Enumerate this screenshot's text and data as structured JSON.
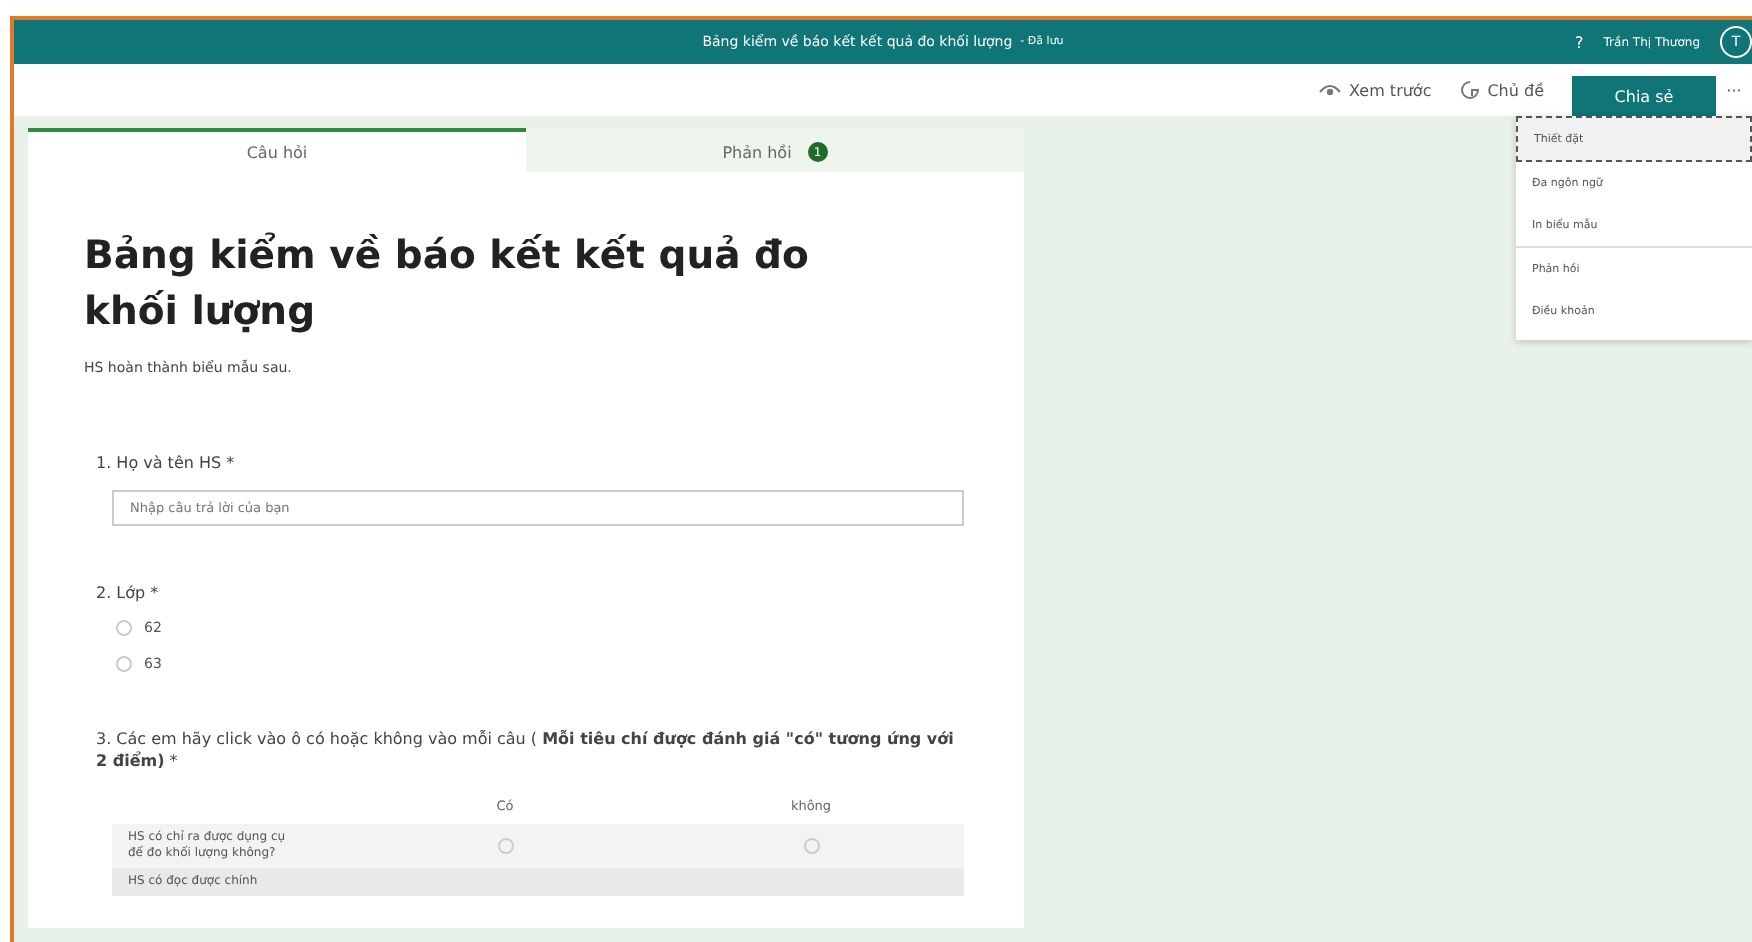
{
  "header": {
    "title": "Bảng kiểm về báo kết kết quả đo khối lượng",
    "save_status": "- Đã lưu",
    "help": "?",
    "user_name": "Trần Thị Thương",
    "avatar_initials": "T"
  },
  "toolbar": {
    "preview": "Xem trước",
    "theme": "Chủ đề",
    "share": "Chia sẻ",
    "more": "···"
  },
  "menu": {
    "items": [
      {
        "label": "Thiết đặt",
        "selected": true
      },
      {
        "label": "Đa ngôn ngữ",
        "selected": false
      },
      {
        "label": "In biểu mẫu",
        "selected": false
      },
      {
        "label": "Phản hồi",
        "selected": false
      },
      {
        "label": "Điều khoản",
        "selected": false
      }
    ]
  },
  "tabs": [
    {
      "label": "Câu hỏi",
      "selected": true
    },
    {
      "label": "Phản hồi",
      "selected": false,
      "badge": "1"
    }
  ],
  "form": {
    "title": "Bảng kiểm về báo kết kết quả đo khối lượng",
    "description": "HS hoàn thành biểu mẫu sau.",
    "questions": [
      {
        "kind": "text",
        "label": "1. Họ và tên HS *",
        "placeholder": "Nhập câu trả lời của bạn"
      },
      {
        "kind": "choice",
        "label": "2. Lớp *",
        "options": [
          {
            "label": "62",
            "selected": false
          },
          {
            "label": "63",
            "selected": false
          }
        ]
      },
      {
        "kind": "matrix",
        "label": "3. Các em hãy click vào ô có hoặc không vào mỗi câu ( **Mỗi tiêu chí được đánh giá \"có\" tương ứng với 2 điểm)** *",
        "columns": [
          "Có",
          "không"
        ],
        "rows": [
          {
            "label": "HS có chỉ ra được dụng cụ để đo khối lượng không?",
            "answers": [
              false,
              false
            ]
          },
          {
            "label": "HS có đọc được chính",
            "answers": []
          }
        ]
      }
    ]
  }
}
